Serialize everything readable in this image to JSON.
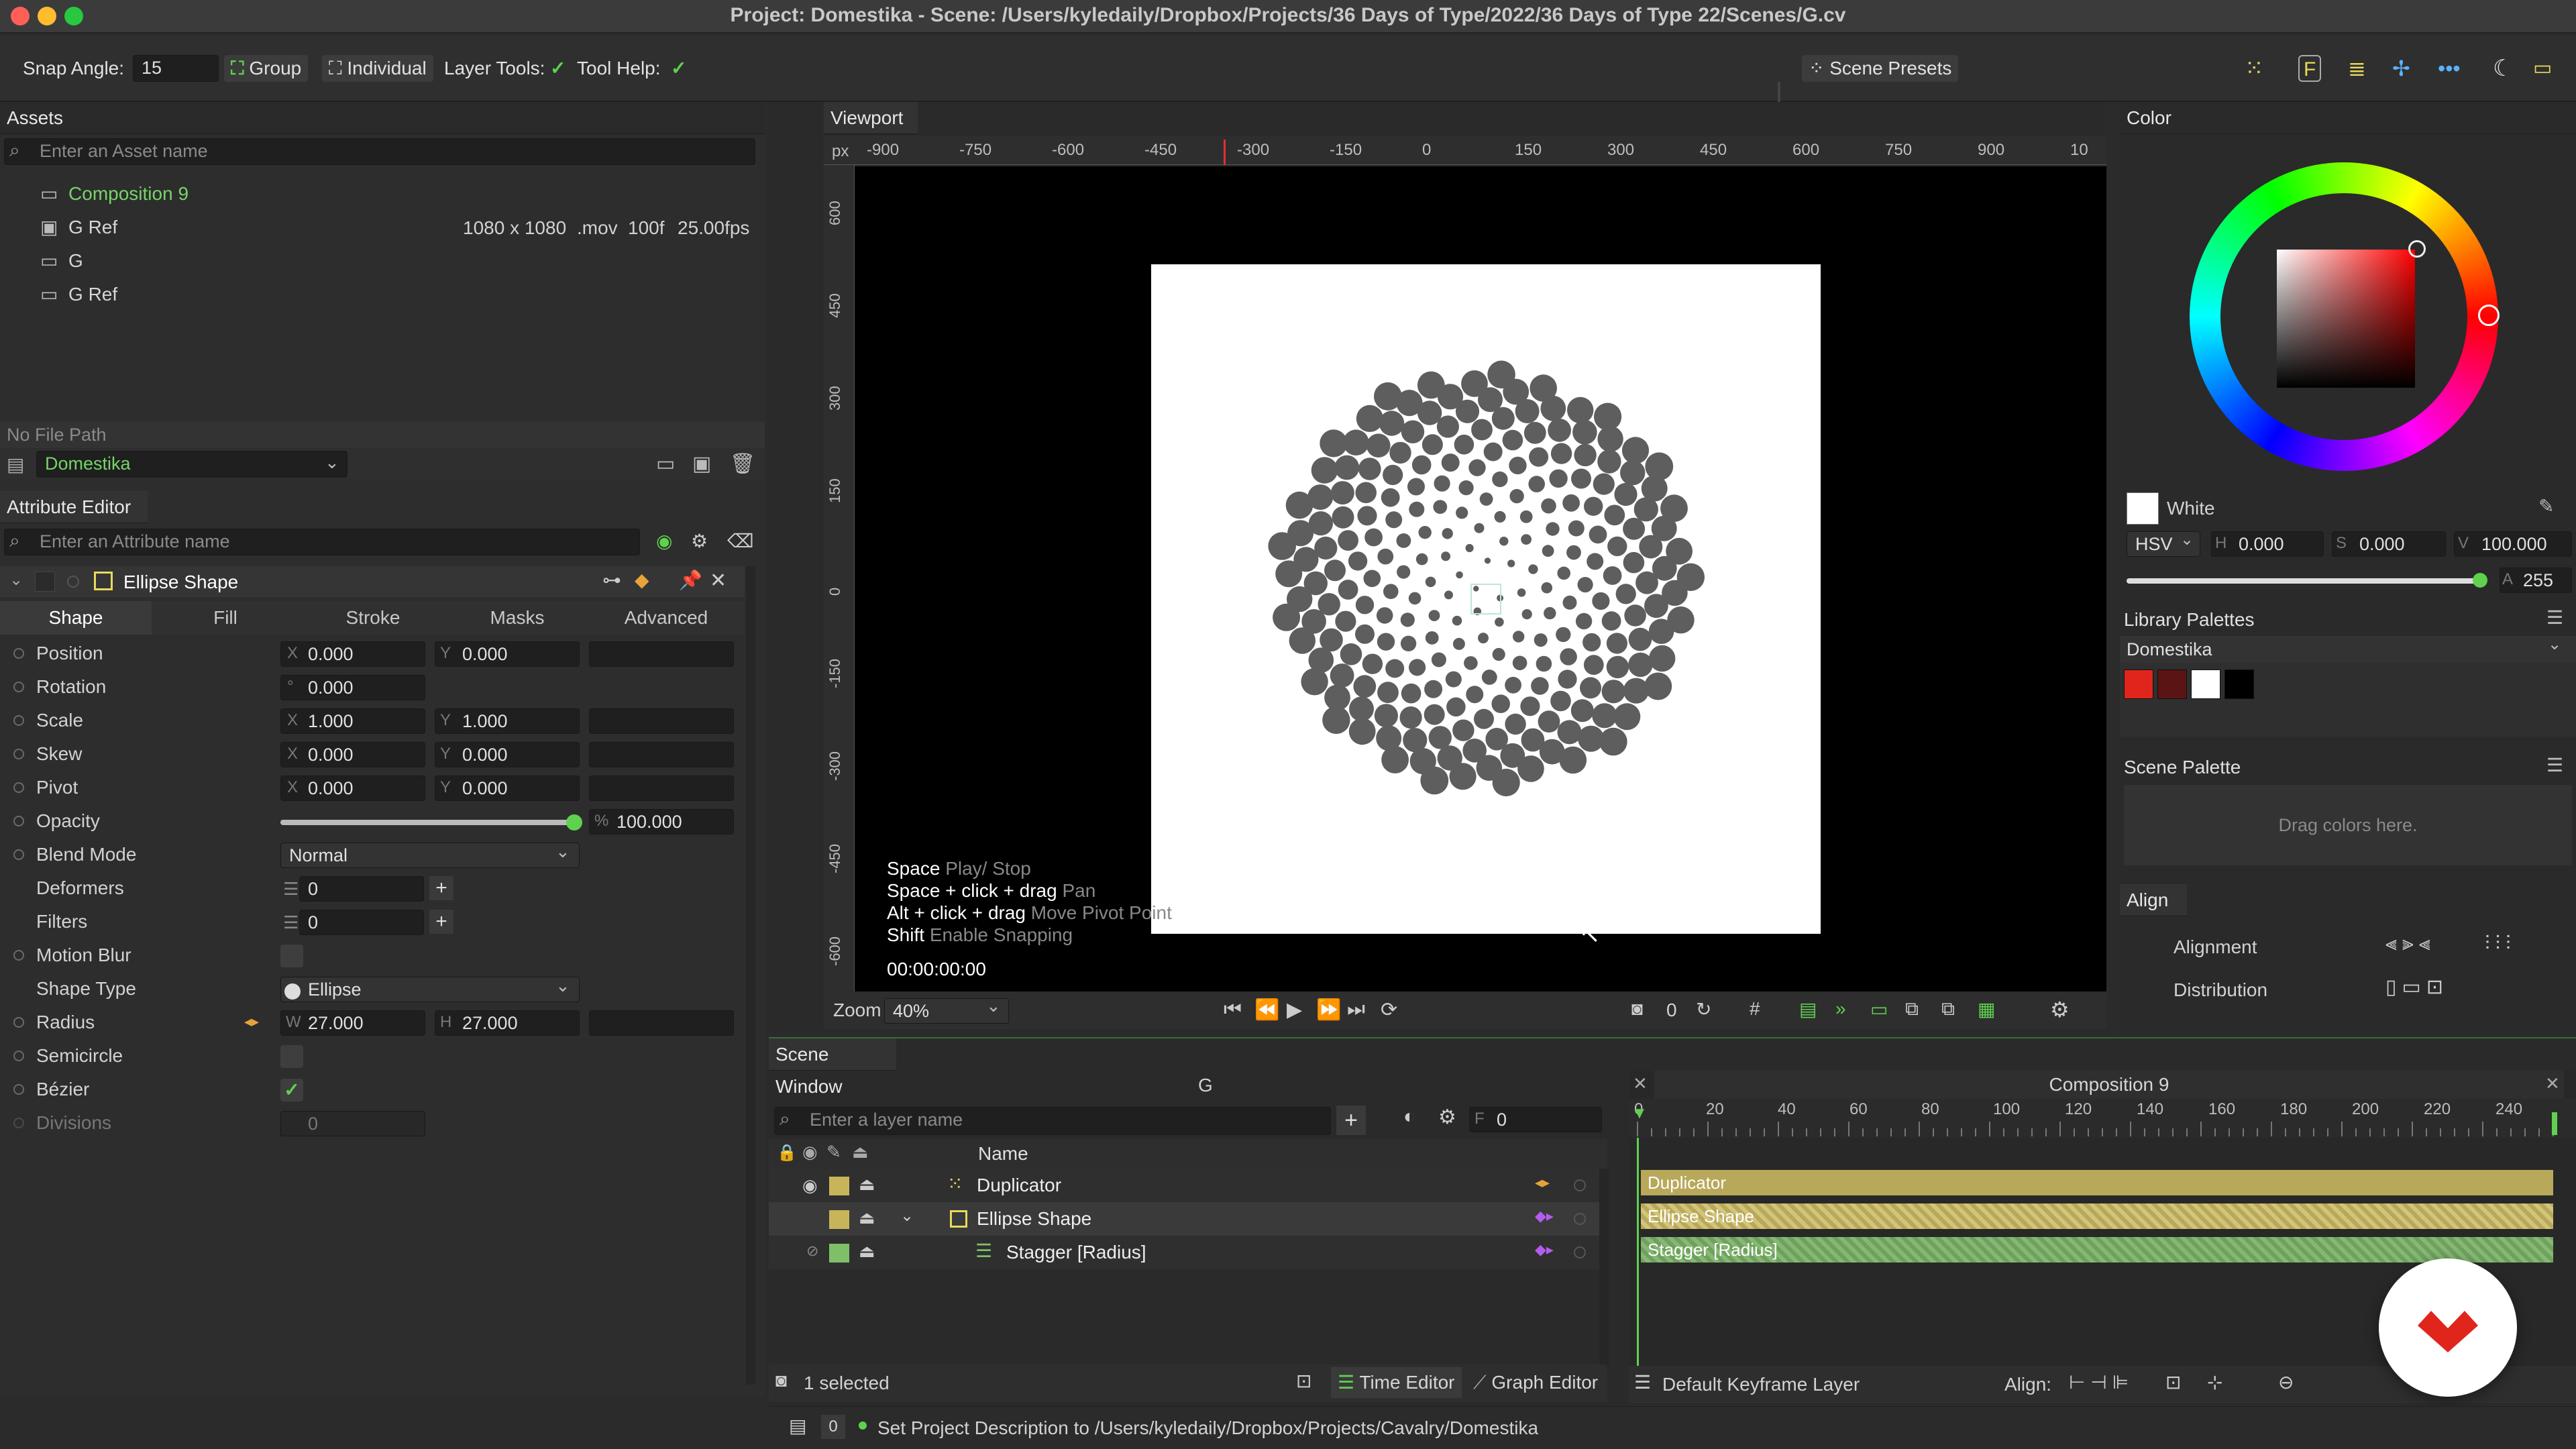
{
  "window": {
    "title": "Project: Domestika - Scene: /Users/kyledaily/Dropbox/Projects/36 Days of Type/2022/36 Days of Type 22/Scenes/G.cv"
  },
  "toolbar": {
    "snap_angle_label": "Snap Angle:",
    "snap_angle_value": "15",
    "group_label": "Group",
    "individual_label": "Individual",
    "layer_tools_label": "Layer Tools:",
    "tool_help_label": "Tool Help:",
    "scene_presets_label": "Scene Presets",
    "check": "✓"
  },
  "assets": {
    "title": "Assets",
    "search_placeholder": "Enter an Asset name",
    "items": [
      {
        "name": "Composition 9"
      },
      {
        "name": "G Ref",
        "res": "1080 x 1080",
        "ext": ".mov",
        "frames": "100f",
        "fps": "25.00fps"
      },
      {
        "name": "G"
      },
      {
        "name": "G Ref"
      }
    ],
    "file_path": "No File Path",
    "project": "Domestika"
  },
  "attribute_editor": {
    "title": "Attribute Editor",
    "search_placeholder": "Enter an Attribute name",
    "layer_name": "Ellipse Shape",
    "tabs": [
      "Shape",
      "Fill",
      "Stroke",
      "Masks",
      "Advanced"
    ],
    "position": {
      "label": "Position",
      "x_lbl": "X",
      "x": "0.000",
      "y_lbl": "Y",
      "y": "0.000"
    },
    "rotation": {
      "label": "Rotation",
      "deg": "°",
      "value": "0.000"
    },
    "scale": {
      "label": "Scale",
      "x_lbl": "X",
      "x": "1.000",
      "y_lbl": "Y",
      "y": "1.000"
    },
    "skew": {
      "label": "Skew",
      "x_lbl": "X",
      "x": "0.000",
      "y_lbl": "Y",
      "y": "0.000"
    },
    "pivot": {
      "label": "Pivot",
      "x_lbl": "X",
      "x": "0.000",
      "y_lbl": "Y",
      "y": "0.000"
    },
    "opacity": {
      "label": "Opacity",
      "pct": "%",
      "value": "100.000",
      "level": 1.0
    },
    "blend_mode": {
      "label": "Blend Mode",
      "value": "Normal"
    },
    "deformers": {
      "label": "Deformers",
      "value": "0"
    },
    "filters": {
      "label": "Filters",
      "value": "0"
    },
    "motion_blur": {
      "label": "Motion Blur"
    },
    "shape_type": {
      "label": "Shape Type",
      "value": "Ellipse"
    },
    "radius": {
      "label": "Radius",
      "w_lbl": "W",
      "w": "27.000",
      "h_lbl": "H",
      "h": "27.000"
    },
    "semicircle": {
      "label": "Semicircle"
    },
    "bezier": {
      "label": "Bézier"
    },
    "divisions": {
      "label": "Divisions",
      "value": "0"
    }
  },
  "viewport": {
    "title": "Viewport",
    "unit": "px",
    "ruler_x": [
      "-900",
      "-750",
      "-600",
      "-450",
      "-300",
      "-150",
      "0",
      "150",
      "300",
      "450",
      "600",
      "750",
      "900",
      "10"
    ],
    "ruler_y": [
      "600",
      "450",
      "300",
      "150",
      "0",
      "-150",
      "-300",
      "-450",
      "-600"
    ],
    "help": [
      {
        "key": "Space",
        "desc": "Play/ Stop"
      },
      {
        "key": "Space + click + drag",
        "desc": "Pan"
      },
      {
        "key": "Alt + click + drag",
        "desc": "Move Pivot Point"
      },
      {
        "key": "Shift",
        "desc": "Enable Snapping"
      }
    ],
    "timecode": "00:00:00:00",
    "zoom_label": "Zoom",
    "zoom_value": "40%",
    "frame_counter": "0"
  },
  "color": {
    "title": "Color",
    "name": "White",
    "mode": "HSV",
    "h_lbl": "H",
    "h": "0.000",
    "s_lbl": "S",
    "s": "0.000",
    "v_lbl": "V",
    "v": "100.000",
    "a_lbl": "A",
    "alpha": "255",
    "library_title": "Library Palettes",
    "library_name": "Domestika",
    "swatches": [
      "#e0261c",
      "#5a1414",
      "#ffffff",
      "#000000"
    ],
    "scene_palette_title": "Scene Palette",
    "scene_palette_hint": "Drag colors here."
  },
  "align": {
    "title": "Align",
    "alignment_label": "Alignment",
    "distribution_label": "Distribution"
  },
  "scene_window": {
    "title": "Scene Window",
    "comp_name": "G",
    "search_placeholder": "Enter a layer name",
    "frame_lbl": "F",
    "frame_value": "0",
    "name_header": "Name",
    "layers": [
      {
        "name": "Duplicator",
        "color": "#c8b55a"
      },
      {
        "name": "Ellipse Shape",
        "color": "#c8b55a"
      },
      {
        "name": "Stagger [Radius]",
        "color": "#7fbf6a"
      }
    ],
    "selected_count": "1 selected",
    "time_editor_label": "Time Editor",
    "graph_editor_label": "Graph Editor"
  },
  "timeline": {
    "comp_title": "Composition 9",
    "ticks": [
      "0",
      "20",
      "40",
      "60",
      "80",
      "100",
      "120",
      "140",
      "160",
      "180",
      "200",
      "220",
      "240"
    ],
    "tracks": [
      "Duplicator",
      "Ellipse Shape",
      "Stagger [Radius]"
    ],
    "keyframe_layer": "Default Keyframe Layer",
    "align_label": "Align:"
  },
  "status_bar": {
    "count": "0",
    "message": "Set Project Description to /Users/kyledaily/Dropbox/Projects/Cavalry/Domestika"
  },
  "accent": "#5fd14f",
  "brand_badge_color": "#e0261c"
}
